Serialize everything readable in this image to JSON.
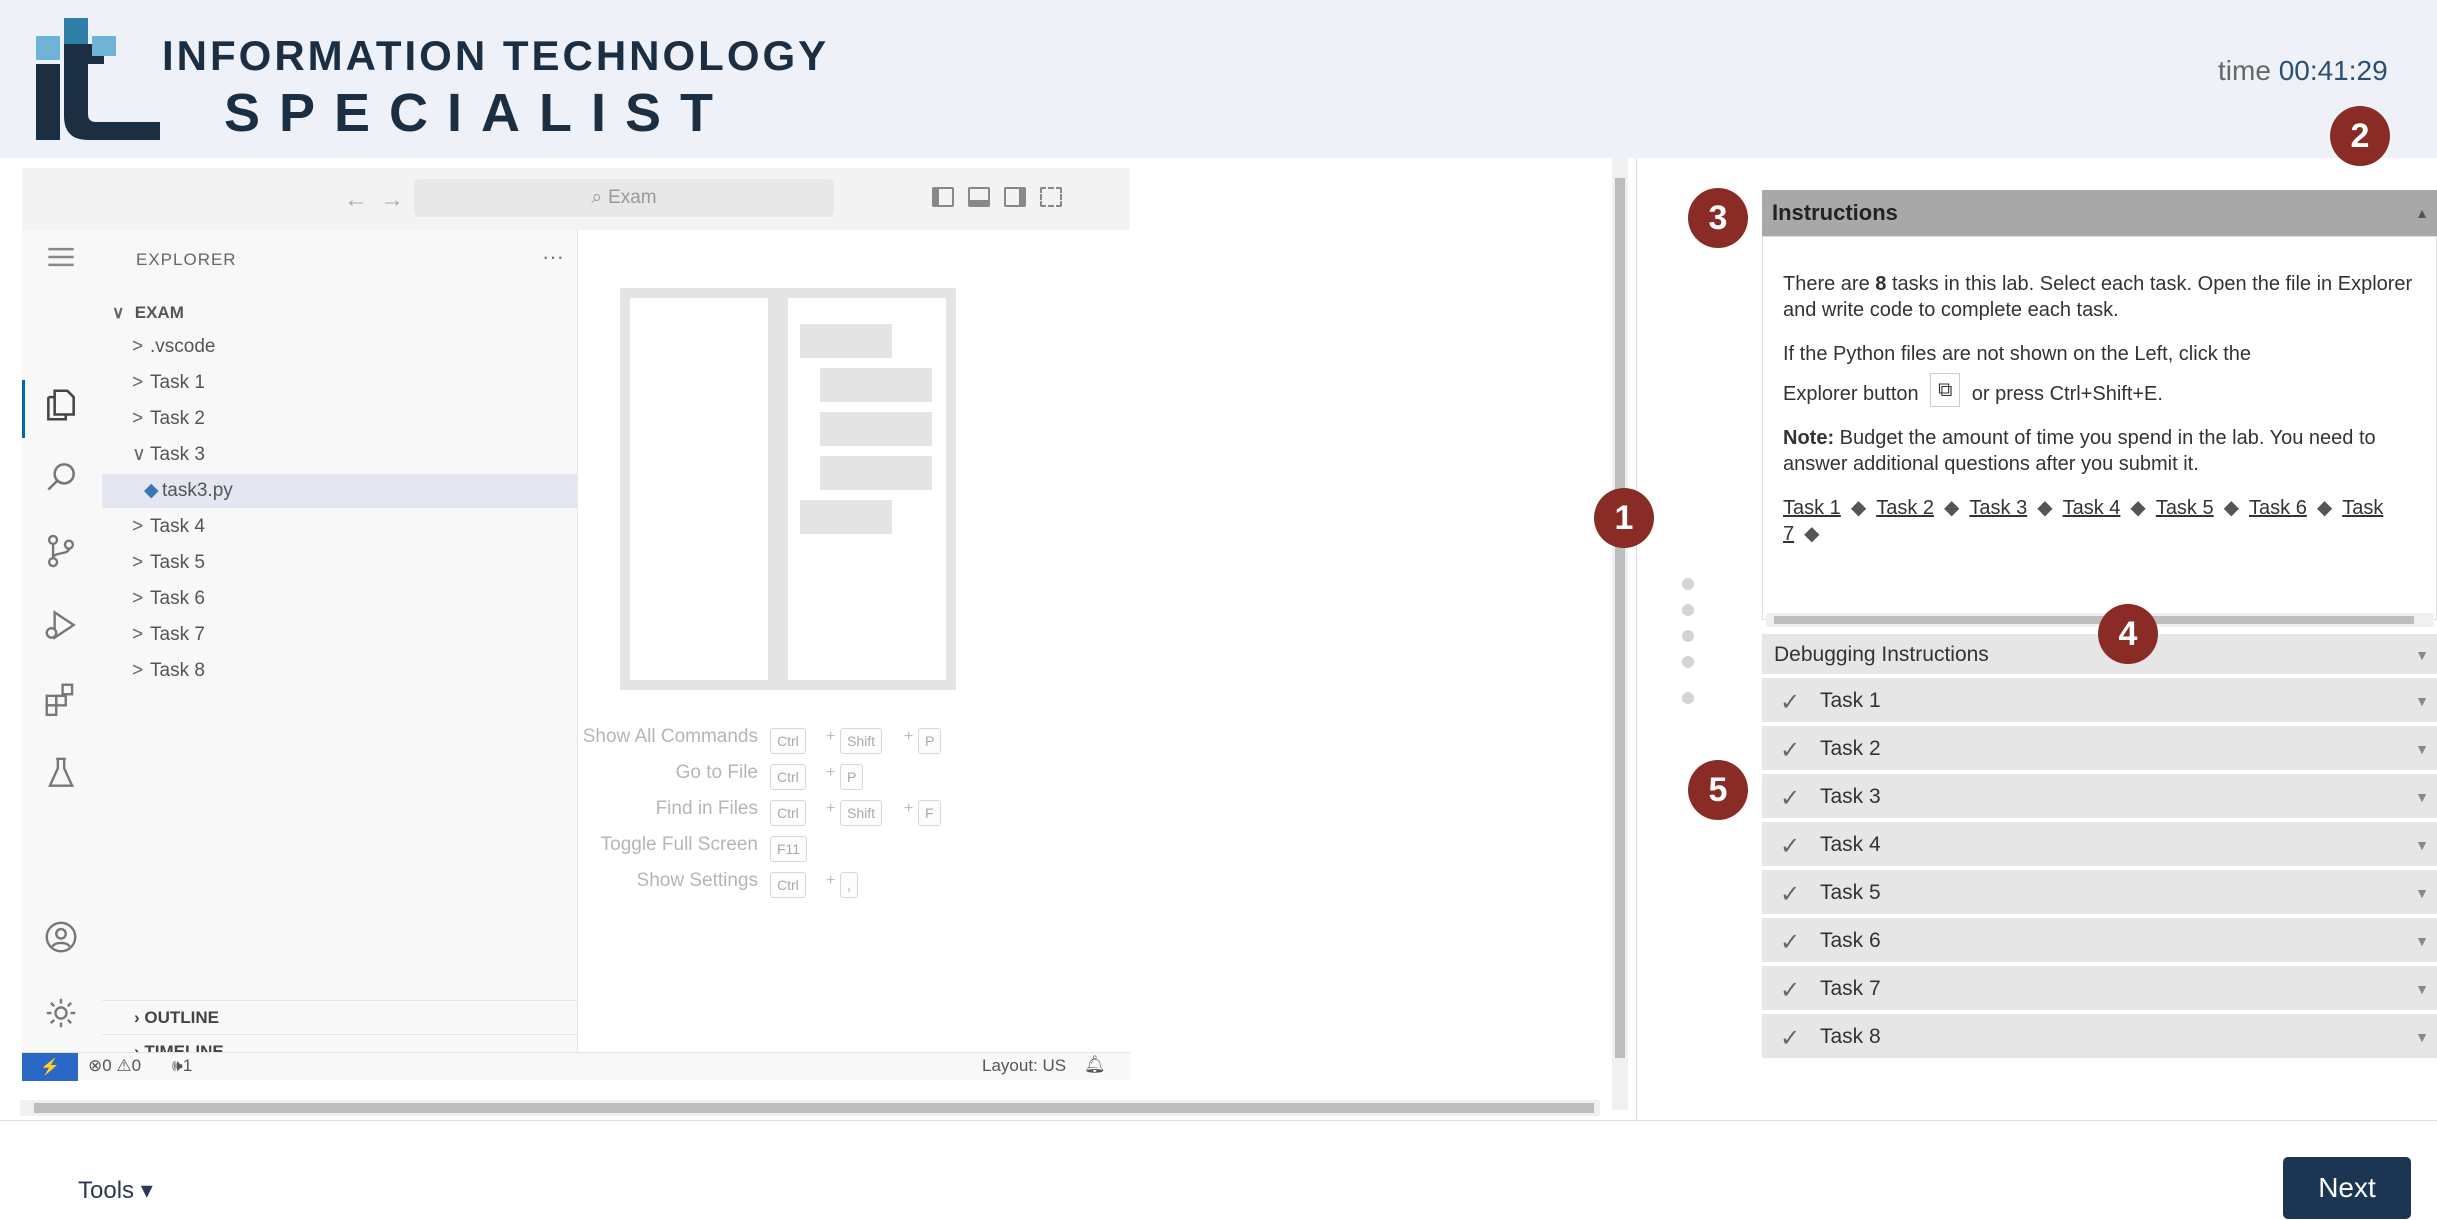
{
  "header": {
    "logo_line1": "INFORMATION TECHNOLOGY",
    "logo_line2": "SPECIALIST",
    "timer_label": "time",
    "timer_value": "00:41:29"
  },
  "badges": [
    "1",
    "2",
    "3",
    "4",
    "5"
  ],
  "vscode": {
    "search_placeholder": "Exam",
    "sidebar_title": "EXPLORER",
    "sidebar_more": "···",
    "root_folder": "EXAM",
    "tree": [
      {
        "label": ".vscode",
        "chevron": ">"
      },
      {
        "label": "Task 1",
        "chevron": ">"
      },
      {
        "label": "Task 2",
        "chevron": ">"
      },
      {
        "label": "Task 3",
        "chevron": "∨"
      },
      {
        "label": "task3.py",
        "chevron": "◆",
        "selected": true
      },
      {
        "label": "Task 4",
        "chevron": ">"
      },
      {
        "label": "Task 5",
        "chevron": ">"
      },
      {
        "label": "Task 6",
        "chevron": ">"
      },
      {
        "label": "Task 7",
        "chevron": ">"
      },
      {
        "label": "Task 8",
        "chevron": ">"
      }
    ],
    "outline_label": "OUTLINE",
    "timeline_label": "TIMELINE",
    "shortcuts": [
      {
        "label": "Show All Commands",
        "keys": [
          "Ctrl",
          "Shift",
          "P"
        ]
      },
      {
        "label": "Go to File",
        "keys": [
          "Ctrl",
          "P"
        ]
      },
      {
        "label": "Find in Files",
        "keys": [
          "Ctrl",
          "Shift",
          "F"
        ]
      },
      {
        "label": "Toggle Full Screen",
        "keys": [
          "F11"
        ]
      },
      {
        "label": "Show Settings",
        "keys": [
          "Ctrl",
          ","
        ]
      }
    ],
    "status": {
      "problems": "⊗0 ⚠0",
      "ports": "🕪1",
      "layout": "Layout: US"
    }
  },
  "instructions": {
    "title": "Instructions",
    "p1_pre": "There are ",
    "p1_bold": "8",
    "p1_post": " tasks in this lab. Select each task. Open the file in Explorer and write code to complete each task.",
    "p2": "If the Python files are not shown on the Left, click the",
    "p3_pre": "Explorer button",
    "p3_post": "or press Ctrl+Shift+E.",
    "note_bold": "Note:",
    "note_text": " Budget the amount of time you spend in the lab. You need to answer additional questions after you submit it.",
    "task_links": [
      "Task 1",
      "Task 2",
      "Task 3",
      "Task 4",
      "Task 5",
      "Task 6",
      "Task 7"
    ]
  },
  "accordion": {
    "debugging": "Debugging Instructions",
    "tasks": [
      "Task 1",
      "Task 2",
      "Task 3",
      "Task 4",
      "Task 5",
      "Task 6",
      "Task 7",
      "Task 8"
    ]
  },
  "footer": {
    "tools": "Tools ▾",
    "next": "Next"
  },
  "colors": {
    "header_bg": "#eef2f8",
    "badge": "#8b2b26",
    "next_button": "#1b3553",
    "logo_dark": "#1c2e42",
    "logo_accent": "#2f7fa8"
  }
}
